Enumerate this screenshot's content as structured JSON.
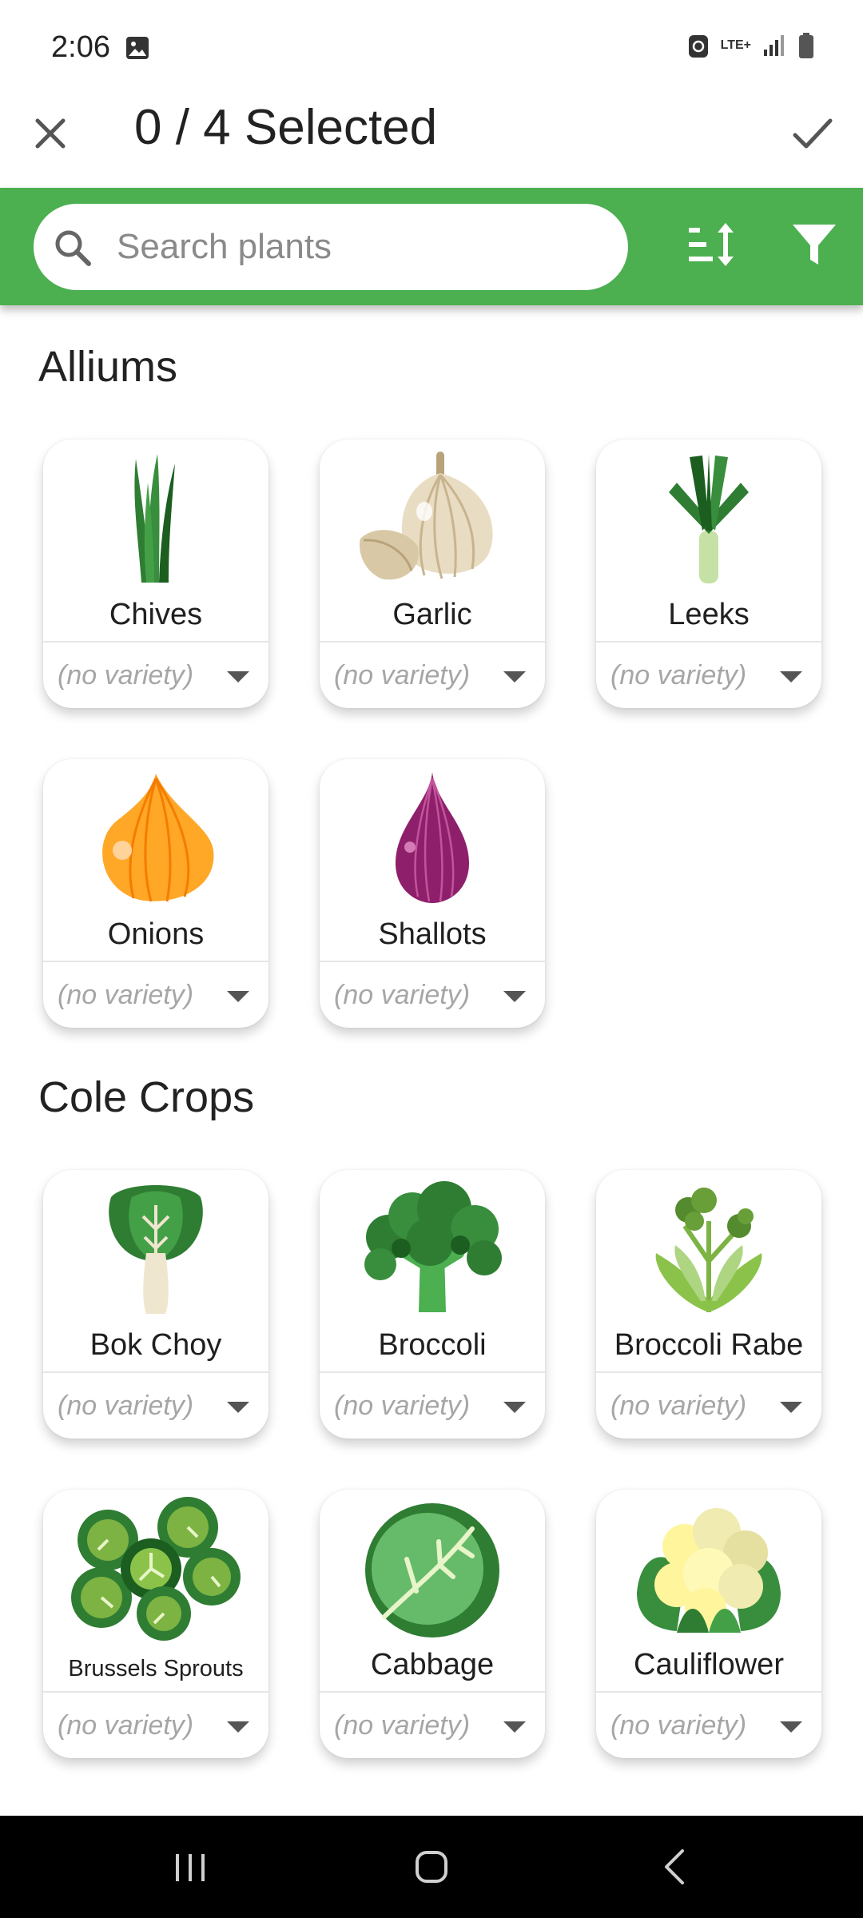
{
  "status": {
    "time": "2:06",
    "network": "LTE+"
  },
  "appbar": {
    "title": "0 / 4 Selected"
  },
  "search": {
    "placeholder": "Search plants"
  },
  "sections": [
    {
      "title": "Alliums",
      "items": [
        {
          "name": "Chives",
          "variety": "(no variety)",
          "icon": "chives-icon"
        },
        {
          "name": "Garlic",
          "variety": "(no variety)",
          "icon": "garlic-icon"
        },
        {
          "name": "Leeks",
          "variety": "(no variety)",
          "icon": "leeks-icon"
        },
        {
          "name": "Onions",
          "variety": "(no variety)",
          "icon": "onion-icon"
        },
        {
          "name": "Shallots",
          "variety": "(no variety)",
          "icon": "shallot-icon"
        }
      ]
    },
    {
      "title": "Cole Crops",
      "items": [
        {
          "name": "Bok Choy",
          "variety": "(no variety)",
          "icon": "bok-choy-icon"
        },
        {
          "name": "Broccoli",
          "variety": "(no variety)",
          "icon": "broccoli-icon"
        },
        {
          "name": "Broccoli Rabe",
          "variety": "(no variety)",
          "icon": "broccoli-rabe-icon"
        },
        {
          "name": "Brussels Sprouts",
          "variety": "(no variety)",
          "icon": "brussels-sprouts-icon"
        },
        {
          "name": "Cabbage",
          "variety": "(no variety)",
          "icon": "cabbage-icon"
        },
        {
          "name": "Cauliflower",
          "variety": "(no variety)",
          "icon": "cauliflower-icon"
        }
      ]
    }
  ],
  "colors": {
    "header_green": "#4caf50",
    "placeholder_gray": "#8a8a8a",
    "variety_gray": "#a6a6a6"
  }
}
